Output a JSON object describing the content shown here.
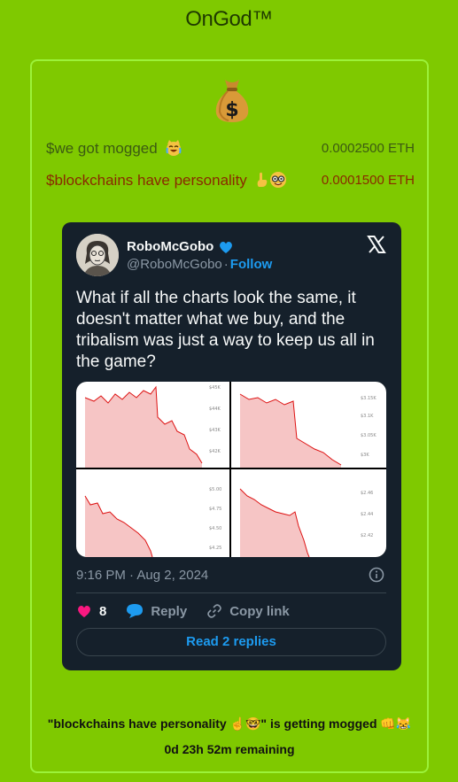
{
  "app": {
    "title": "OnGod™"
  },
  "tokens": [
    {
      "name": "$we got mogged",
      "emoji": "😹",
      "price": "0.0002500 ETH",
      "color": "#3c5a12"
    },
    {
      "name": "$blockchains have personality",
      "emoji": "☝️🤓",
      "price": "0.0001500 ETH",
      "color": "#8a2a00"
    }
  ],
  "tweet": {
    "author_name": "RoboMcGobo",
    "handle": "@RoboMcGobo",
    "separator": "·",
    "follow_label": "Follow",
    "text": "What if all the charts look the same, it doesn't matter what we buy, and the tribalism was just a way to keep us all in the game?",
    "timestamp": "9:16 PM · Aug 2, 2024",
    "likes_count": "8",
    "reply_label": "Reply",
    "copy_link_label": "Copy link",
    "read_replies_label": "Read 2 replies",
    "icons": [
      "x-logo-icon",
      "verified-heart-icon",
      "info-icon",
      "heart-icon",
      "reply-bubble-icon",
      "link-icon"
    ],
    "colors": {
      "background": "#15202b",
      "accent": "#1d9bf0",
      "like": "#f91880",
      "muted": "#8b98a5"
    }
  },
  "status": {
    "line1": "\"blockchains have personality ☝️🤓\" is getting mogged 👊😹",
    "line2": "0d 23h 52m remaining"
  },
  "colors": {
    "page_background": "#7fc900",
    "panel_border": "#9cf23a"
  }
}
